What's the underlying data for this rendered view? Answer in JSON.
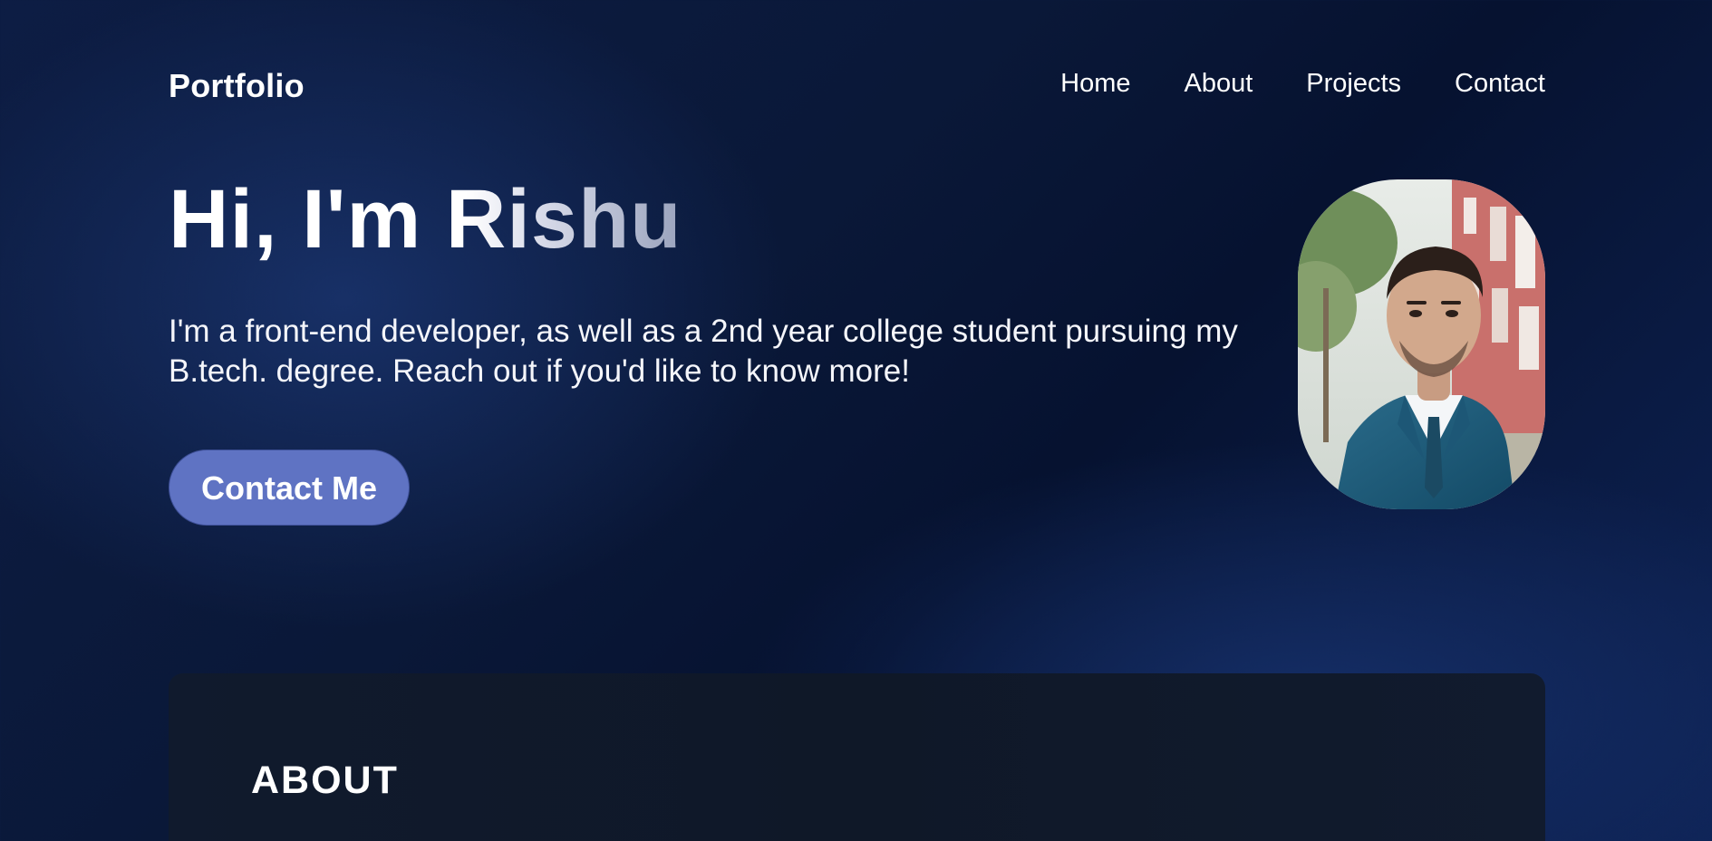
{
  "nav": {
    "brand": "Portfolio",
    "links": [
      "Home",
      "About",
      "Projects",
      "Contact"
    ]
  },
  "hero": {
    "title": "Hi, I'm Rishu",
    "text": "I'm a front-end developer, as well as a 2nd year college student pursuing my B.tech. degree. Reach out if you'd like to know more!",
    "cta_label": "Contact Me"
  },
  "about": {
    "title": "ABOUT"
  },
  "colors": {
    "background": "#0a1838",
    "button": "#5f73c3",
    "card": "#101a2d"
  },
  "icons": {
    "portrait": "profile-photo"
  }
}
